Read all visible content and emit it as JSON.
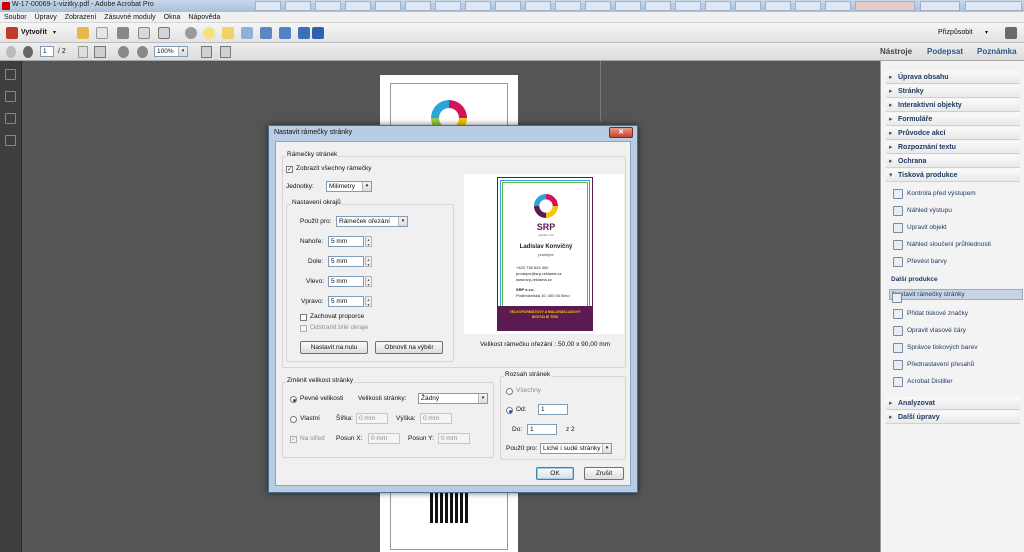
{
  "window": {
    "title": "W-17-00069-1-vizitky.pdf - Adobe Acrobat Pro"
  },
  "menu": [
    "Soubor",
    "Úpravy",
    "Zobrazení",
    "Zásuvné moduly",
    "Okna",
    "Nápověda"
  ],
  "toolbar": {
    "create_label": "Vytvořit",
    "customize_label": "Přizpůsobit"
  },
  "nav": {
    "page_current": "1",
    "page_total": "/ 2",
    "zoom": "100%"
  },
  "right_tabs": {
    "tools": "Nástroje",
    "sign": "Podepsat",
    "comment": "Poznámka"
  },
  "panel": {
    "sections_top": [
      "Úprava obsahu",
      "Stránky",
      "Interaktivní objekty",
      "Formuláře",
      "Průvodce akcí",
      "Rozpoznání textu",
      "Ochrana"
    ],
    "print_section": "Tisková produkce",
    "print_items": [
      "Kontrola před výstupem",
      "Náhled výstupu",
      "Upravit objekt",
      "Náhled sloučení průhlednosti",
      "Převést barvy"
    ],
    "more_heading": "Další produkce",
    "more_items": [
      "Nastavit rámečky stránky",
      "Přidat tiskové značky",
      "Opravit vlasové čáry",
      "Správce tiskových barev",
      "Přednastavení přesahů",
      "Acrobat Distiller"
    ],
    "sections_bottom": [
      "Analyzovat",
      "Další úpravy"
    ]
  },
  "dialog": {
    "title": "Nastavit rámečky stránky",
    "page_boxes_group": "Rámečky stránek",
    "show_all_boxes": "Zobrazit všechny rámečky",
    "units_label": "Jednotky:",
    "units_value": "Milimetry",
    "margins_group": "Nastavení okrajů",
    "apply_to_label": "Použít pro:",
    "apply_to_value": "Rámeček ořezání",
    "top_label": "Nahoře:",
    "top_value": "5 mm",
    "bottom_label": "Dole:",
    "bottom_value": "5 mm",
    "left_label": "Vlevo:",
    "left_value": "5 mm",
    "right_label": "Vpravo:",
    "right_value": "5 mm",
    "keep_ratio": "Zachovat proporce",
    "remove_white": "Odstranit bílé okraje",
    "set_zero_button": "Nastavit na nulu",
    "restore_button": "Obnovit na výběr",
    "box_size_caption": "Velikost rámečku ořezání : 50,00 x 90,00 mm",
    "resize_group": "Změnit velikost stránky",
    "fixed_sizes": "Pevné velikosti",
    "page_sizes_label": "Velikosti stránky:",
    "page_sizes_value": "Žádný",
    "custom": "Vlastní",
    "width_label": "Šířka:",
    "width_value": "0 mm",
    "height_label": "Výška:",
    "height_value": "0 mm",
    "center": "Na střed",
    "offset_x_label": "Posun X:",
    "offset_x_value": "0 mm",
    "offset_y_label": "Posun Y:",
    "offset_y_value": "0 mm",
    "range_group": "Rozsah stránek",
    "all": "Všechny",
    "from_label": "Od:",
    "from_value": "1",
    "to_label": "Do:",
    "to_value": "1",
    "of_label": "z 2",
    "range_apply_label": "Použít pro:",
    "range_apply_value": "Liché i sudé stránky",
    "ok": "OK",
    "cancel": "Zrušit"
  },
  "card": {
    "logo": "SRP",
    "logo_sub": "digitální tisk",
    "name": "Ladislav Konvičný",
    "role": "prodejce",
    "phone": "+420 736 624 400",
    "email": "prodejce@srp-reklama.cz",
    "web": "www.srp-reklama.cz",
    "company": "SRP s.r.o.",
    "address": "Podmokelská 10, 400 04 Brno",
    "footer1": "VELKOFORMÁTOVÝ A MALONÁKLADOVÝ",
    "footer2": "DIGITÁLNÍ TISK"
  },
  "colors": {
    "accent_purple": "#5b1b52",
    "magenta": "#d4145a",
    "yellow": "#f7c600",
    "cyan": "#2aa7d8"
  }
}
